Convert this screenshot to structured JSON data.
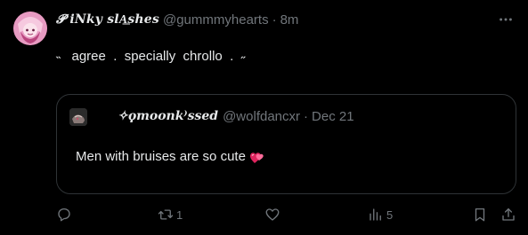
{
  "tweet": {
    "author_name": "𝓟 iNky slA͟shes",
    "author_handle": "@gummmyhearts",
    "separator": "·",
    "time": "8m",
    "text": "˵   agree  .  specially  chrollo  .  ˶"
  },
  "quoted": {
    "author_name": "✧ϙmoonk⁾ssed",
    "author_handle": "@wolfdancxr",
    "separator": "·",
    "time": "Dec 21",
    "text": "Men with bruises are so cute"
  },
  "actions": {
    "reply_count": "",
    "retweet_count": "1",
    "like_count": "",
    "views_count": "5"
  },
  "icons": {
    "more": "more-icon",
    "reply": "reply-icon",
    "retweet": "retweet-icon",
    "like": "like-icon",
    "views": "views-icon",
    "bookmark": "bookmark-icon",
    "share": "share-icon",
    "emoji": "heart-emoji-icon"
  },
  "colors": {
    "background": "#000000",
    "text": "#e7e9ea",
    "secondary": "#71767b",
    "border": "#2f3336"
  }
}
